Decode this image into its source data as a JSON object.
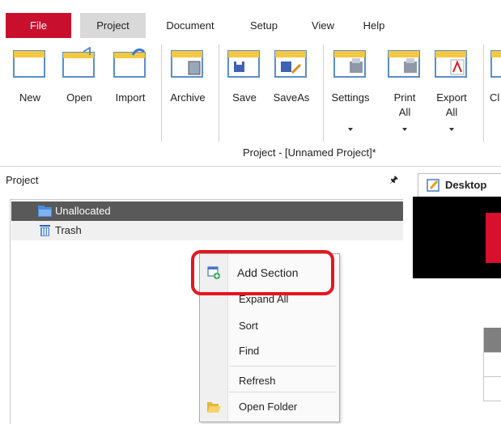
{
  "menu": {
    "file": "File",
    "project": "Project",
    "document": "Document",
    "setup": "Setup",
    "view": "View",
    "help": "Help"
  },
  "ribbon": {
    "buttons": [
      {
        "label": "New",
        "icon": "new-folder-icon"
      },
      {
        "label": "Open",
        "icon": "open-folder-icon"
      },
      {
        "label": "Import",
        "icon": "import-folder-icon"
      },
      {
        "label": "Archive",
        "icon": "archive-icon"
      },
      {
        "label": "Save",
        "icon": "save-icon"
      },
      {
        "label": "SaveAs",
        "icon": "save-as-icon"
      },
      {
        "label": "Settings",
        "icon": "settings-icon"
      },
      {
        "label": "Print\nAll",
        "icon": "print-icon"
      },
      {
        "label": "Export\nAll",
        "icon": "pdf-export-icon"
      },
      {
        "label": "Cl",
        "icon": "partial-icon"
      }
    ],
    "group_label": "Project - [Unnamed Project]*"
  },
  "pane": {
    "title": "Project",
    "pin": "⪰",
    "tree": [
      {
        "label": "Unallocated",
        "icon": "folder-icon",
        "selected": true
      },
      {
        "label": "Trash",
        "icon": "trash-icon",
        "selected": false
      }
    ]
  },
  "desktop_tab": {
    "label": "Desktop",
    "icon": "edit-document-icon"
  },
  "context_menu": {
    "items": [
      "Add Section",
      "Expand All",
      "Sort",
      "Find",
      "Refresh",
      "Open Folder"
    ]
  },
  "colors": {
    "file_tab": "#c8102e",
    "selection": "#595959",
    "highlight": "#e8141e"
  }
}
